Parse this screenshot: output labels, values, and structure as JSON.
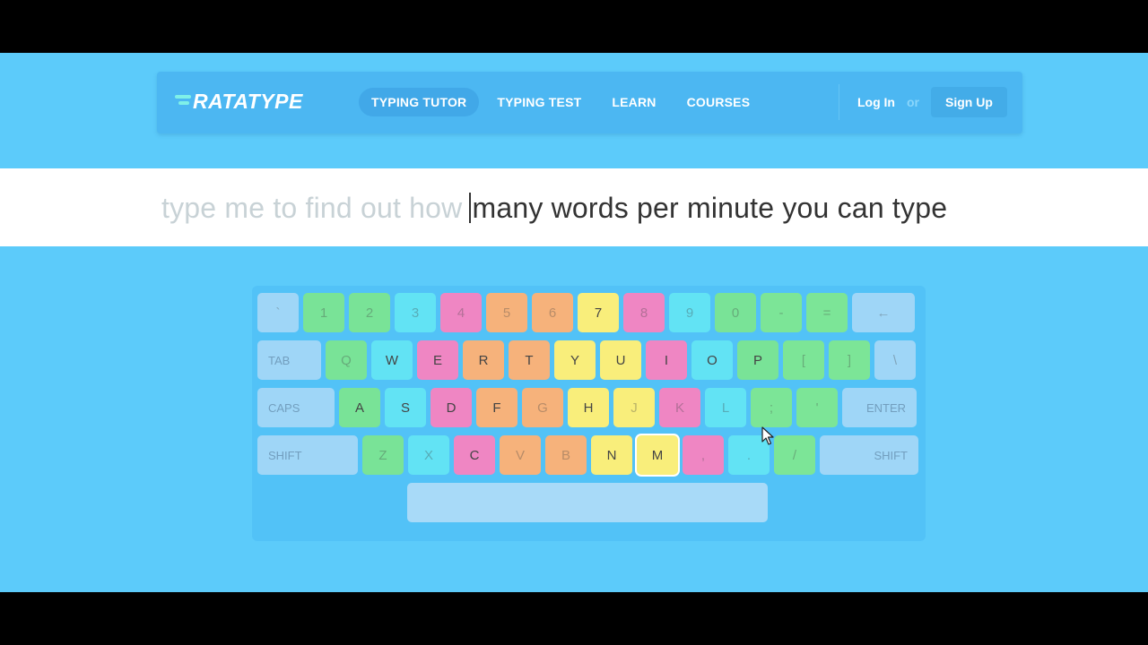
{
  "brand": {
    "name": "RATATYPE"
  },
  "nav": {
    "items": [
      {
        "label": "TYPING TUTOR",
        "active": true
      },
      {
        "label": "TYPING TEST",
        "active": false
      },
      {
        "label": "LEARN",
        "active": false
      },
      {
        "label": "COURSES",
        "active": false
      }
    ],
    "login_label": "Log In",
    "or_label": "or",
    "signup_label": "Sign Up"
  },
  "typing": {
    "typed_text": "type me to find out how",
    "pending_text": "many words per minute you can type"
  },
  "keyboard": {
    "rows": [
      [
        {
          "label": "`",
          "color": "gray",
          "faded": true
        },
        {
          "label": "1",
          "color": "green",
          "faded": true
        },
        {
          "label": "2",
          "color": "green",
          "faded": true
        },
        {
          "label": "3",
          "color": "teal",
          "faded": true
        },
        {
          "label": "4",
          "color": "pink",
          "faded": true
        },
        {
          "label": "5",
          "color": "orange",
          "faded": true
        },
        {
          "label": "6",
          "color": "orange",
          "faded": true
        },
        {
          "label": "7",
          "color": "yellow",
          "faded": false
        },
        {
          "label": "8",
          "color": "pink",
          "faded": true
        },
        {
          "label": "9",
          "color": "teal",
          "faded": true
        },
        {
          "label": "0",
          "color": "green",
          "faded": true
        },
        {
          "label": "-",
          "color": "lgreen",
          "faded": true
        },
        {
          "label": "=",
          "color": "lgreen",
          "faded": true
        },
        {
          "label": "←",
          "color": "gray",
          "faded": true,
          "kind": "backspace"
        }
      ],
      [
        {
          "label": "TAB",
          "color": "gray",
          "kind": "mod"
        },
        {
          "label": "Q",
          "color": "green",
          "faded": true
        },
        {
          "label": "W",
          "color": "teal",
          "faded": false
        },
        {
          "label": "E",
          "color": "pink",
          "faded": false
        },
        {
          "label": "R",
          "color": "orange",
          "faded": false
        },
        {
          "label": "T",
          "color": "orange",
          "faded": false
        },
        {
          "label": "Y",
          "color": "yellow",
          "faded": false
        },
        {
          "label": "U",
          "color": "yellow",
          "faded": false
        },
        {
          "label": "I",
          "color": "pink",
          "faded": false
        },
        {
          "label": "O",
          "color": "teal",
          "faded": false
        },
        {
          "label": "P",
          "color": "green",
          "faded": false
        },
        {
          "label": "[",
          "color": "lgreen",
          "faded": true
        },
        {
          "label": "]",
          "color": "lgreen",
          "faded": true
        },
        {
          "label": "\\",
          "color": "gray",
          "faded": true
        }
      ],
      [
        {
          "label": "CAPS",
          "color": "gray",
          "kind": "mod"
        },
        {
          "label": "A",
          "color": "green",
          "faded": false
        },
        {
          "label": "S",
          "color": "teal",
          "faded": false
        },
        {
          "label": "D",
          "color": "pink",
          "faded": false
        },
        {
          "label": "F",
          "color": "orange",
          "faded": false
        },
        {
          "label": "G",
          "color": "orange",
          "faded": true
        },
        {
          "label": "H",
          "color": "yellow",
          "faded": false
        },
        {
          "label": "J",
          "color": "yellow",
          "faded": true
        },
        {
          "label": "K",
          "color": "pink",
          "faded": true
        },
        {
          "label": "L",
          "color": "teal",
          "faded": true
        },
        {
          "label": ";",
          "color": "lgreen",
          "faded": true
        },
        {
          "label": "'",
          "color": "lgreen",
          "faded": true
        },
        {
          "label": "ENTER",
          "color": "gray",
          "kind": "mod-right"
        }
      ],
      [
        {
          "label": "SHIFT",
          "color": "gray",
          "kind": "mod"
        },
        {
          "label": "Z",
          "color": "green",
          "faded": true
        },
        {
          "label": "X",
          "color": "teal",
          "faded": true
        },
        {
          "label": "C",
          "color": "pink",
          "faded": false
        },
        {
          "label": "V",
          "color": "orange",
          "faded": true
        },
        {
          "label": "B",
          "color": "orange",
          "faded": true
        },
        {
          "label": "N",
          "color": "yellow",
          "faded": false
        },
        {
          "label": "M",
          "color": "yellow",
          "faded": false,
          "highlight": true
        },
        {
          "label": ",",
          "color": "pink",
          "faded": true
        },
        {
          "label": ".",
          "color": "teal",
          "faded": true
        },
        {
          "label": "/",
          "color": "lgreen",
          "faded": true
        },
        {
          "label": "SHIFT",
          "color": "gray",
          "kind": "mod-right"
        }
      ],
      [
        {
          "label": "",
          "color": "gray",
          "kind": "space"
        }
      ]
    ]
  },
  "colors": {
    "page_bg": "#5ccbfa",
    "navbar_bg": "#4cb7f2",
    "gray": "#9fd6f7",
    "green": "#79e397",
    "teal": "#62e3f4",
    "pink": "#ef86c3",
    "orange": "#f6b27b",
    "yellow": "#f9ee7b",
    "lgreen": "#7ce597"
  }
}
